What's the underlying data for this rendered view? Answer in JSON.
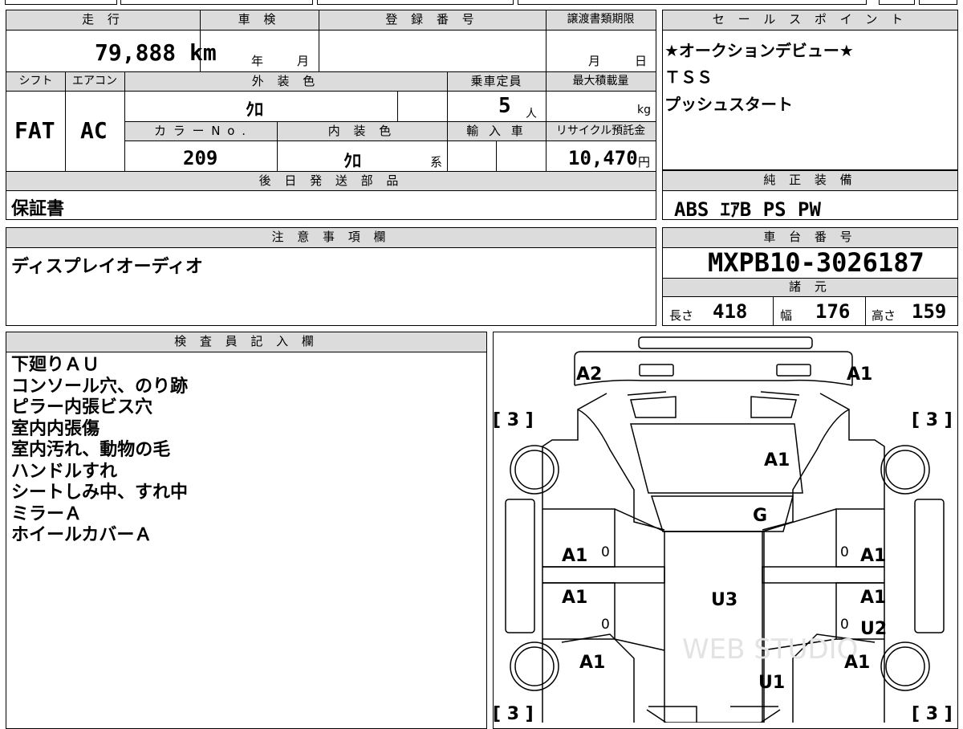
{
  "main_panel": {
    "labels": {
      "mileage": "走 行",
      "shaken": "車 検",
      "reg_no": "登 録 番 号",
      "deadline": "譲渡書類期限",
      "shift": "シフト",
      "aircon": "エアコン",
      "ext_color": "外 装 色",
      "capacity": "乗車定員",
      "max_load": "最大積載量",
      "color_no": "カ ラ ー N o .",
      "int_color": "内 装 色",
      "import": "輸 入 車",
      "recycle": "リサイクル預託金",
      "later_parts": "後 日 発 送 部 品"
    },
    "values": {
      "mileage": "79,888 km",
      "shaken_year_unit": "年",
      "shaken_month_unit": "月",
      "deadline_month_unit": "月",
      "deadline_day_unit": "日",
      "shift": "FAT",
      "aircon": "AC",
      "ext_color": "ｸﾛ",
      "capacity": "5",
      "capacity_unit": "人",
      "max_load_unit": "kg",
      "color_no": "209",
      "int_color": "ｸﾛ",
      "int_color_suffix": "系",
      "recycle": "10,470",
      "recycle_unit": "円",
      "later_parts": "保証書"
    }
  },
  "sales_points": {
    "label": "セ ー ル ス ポ イ ン ト",
    "lines": [
      "★オークションデビュー★",
      "ＴＳＳ",
      "プッシュスタート"
    ]
  },
  "equipment": {
    "label": "純 正 装 備",
    "value": "ABS ｴｱB PS PW"
  },
  "notes": {
    "label": "注 意 事 項 欄",
    "value": "ディスプレイオーディオ"
  },
  "chassis": {
    "label": "車 台 番 号",
    "value": "MXPB10-3026187"
  },
  "specs": {
    "label": "諸 元",
    "length_label": "長さ",
    "length": "418",
    "width_label": "幅",
    "width": "176",
    "height_label": "高さ",
    "height": "159"
  },
  "inspector": {
    "label": "検 査 員 記 入 欄",
    "lines": [
      "下廻りＡＵ",
      "コンソール穴、のり跡",
      "ピラー内張ビス穴",
      "室内内張傷",
      "室内汚れ、動物の毛",
      "ハンドルすれ",
      "シートしみ中、すれ中",
      "ミラーＡ",
      "ホイールカバーＡ"
    ]
  },
  "diagram": {
    "marks": {
      "a2_rear_left": "A2",
      "a1_rear_right": "A1",
      "a1_roof": "A1",
      "g_rear_glass": "G",
      "a1_left_rear_door": "A1",
      "a1_right_rear_door": "A1",
      "a1_left_front_door": "A1",
      "a1_right_front_door": "A1",
      "u3_roof": "U3",
      "u2_right_front_door": "U2",
      "a1_left_fender": "A1",
      "a1_right_fender": "A1",
      "u1_hood": "U1"
    },
    "zeros": [
      "0",
      "0",
      "0",
      "0"
    ],
    "tire_tl": "[ 3 ]",
    "tire_tr": "[ 3 ]",
    "tire_bl": "[ 3 ]",
    "tire_br": "[ 3 ]",
    "watermark": "WEB STUDIO"
  }
}
